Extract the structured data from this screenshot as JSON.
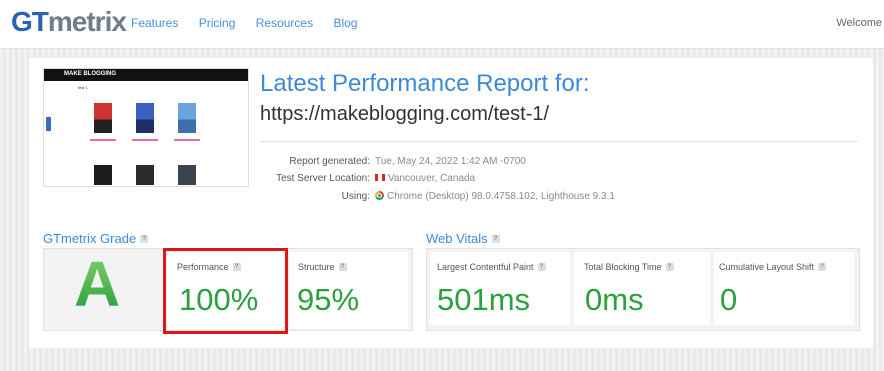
{
  "brand": {
    "logo_a": "GT",
    "logo_b": "metrix"
  },
  "nav": {
    "items": [
      "Features",
      "Pricing",
      "Resources",
      "Blog"
    ],
    "welcome": "Welcome"
  },
  "thumbnail": {
    "site_logo": "MAKE BLOGGING",
    "page_heading": "test 1"
  },
  "report": {
    "title": "Latest Performance Report for:",
    "url": "https://makeblogging.com/test-1/",
    "generated_label": "Report generated:",
    "generated_value": "Tue, May 24, 2022 1:42 AM -0700",
    "server_label": "Test Server Location:",
    "server_value": "Vancouver, Canada",
    "using_label": "Using:",
    "using_value": "Chrome (Desktop) 98.0.4758.102, Lighthouse 9.3.1"
  },
  "grade": {
    "heading": "GTmetrix Grade",
    "letter": "A",
    "performance_label": "Performance",
    "performance_value": "100%",
    "structure_label": "Structure",
    "structure_value": "95%"
  },
  "vitals": {
    "heading": "Web Vitals",
    "lcp_label": "Largest Contentful Paint",
    "lcp_value": "501ms",
    "tbt_label": "Total Blocking Time",
    "tbt_value": "0ms",
    "cls_label": "Cumulative Layout Shift",
    "cls_value": "0"
  },
  "colors": {
    "accent": "#3b8ad9",
    "good": "#2aa13e",
    "highlight": "#e01616"
  },
  "icons": {
    "help": "question-mark-icon",
    "flag": "canada-flag-icon",
    "browser": "chrome-icon"
  }
}
